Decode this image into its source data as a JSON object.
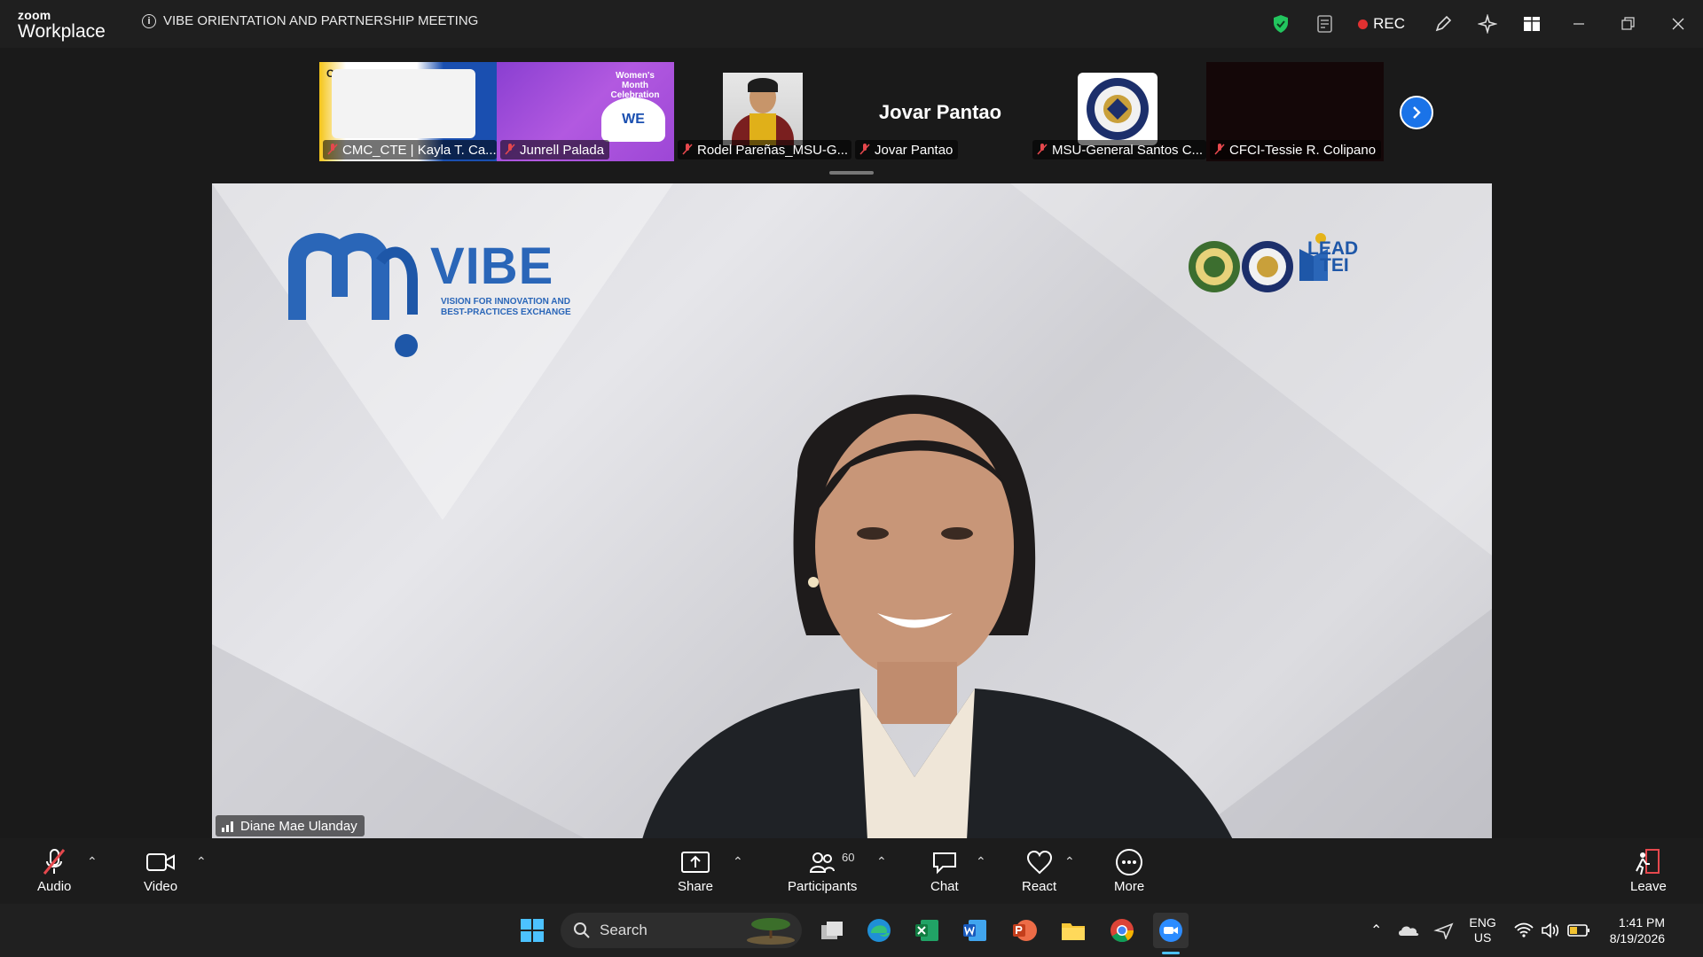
{
  "app": {
    "brand_small": "zoom",
    "brand_big": "Workplace"
  },
  "meeting": {
    "title": "VIBE ORIENTATION AND PARTNERSHIP MEETING",
    "rec_label": "REC"
  },
  "thumbnails": [
    {
      "name": "CMC_CTE | Kayla T. Ca...",
      "logo_text": "CMC"
    },
    {
      "name": "Junrell Palada",
      "banner_text": "Women's Month Celebration",
      "badge_text": "WE"
    },
    {
      "name": "Rodel Pareñas_MSU-G..."
    },
    {
      "name": "Jovar Pantao",
      "display_name": "Jovar Pantao"
    },
    {
      "name": "MSU-General Santos C..."
    },
    {
      "name": "CFCI-Tessie R. Colipano"
    }
  ],
  "main_video": {
    "speaker": "Diane Mae Ulanday",
    "vibe_word": "VIBE",
    "vibe_sub_line1": "VISION FOR INNOVATION AND",
    "vibe_sub_line2": "BEST-PRACTICES EXCHANGE",
    "lead_line1": "LEAD",
    "lead_line2": "TEI"
  },
  "controls": {
    "audio": "Audio",
    "video": "Video",
    "share": "Share",
    "participants": "Participants",
    "participants_count": "60",
    "chat": "Chat",
    "react": "React",
    "more": "More",
    "leave": "Leave"
  },
  "taskbar": {
    "search_placeholder": "Search",
    "lang_line1": "ENG",
    "lang_line2": "US",
    "time": "1:41 PM",
    "date": "8/19/2026"
  },
  "colors": {
    "accent": "#1a73e8",
    "rec": "#e03131",
    "shield": "#22c55e",
    "leave": "#e5484d"
  }
}
